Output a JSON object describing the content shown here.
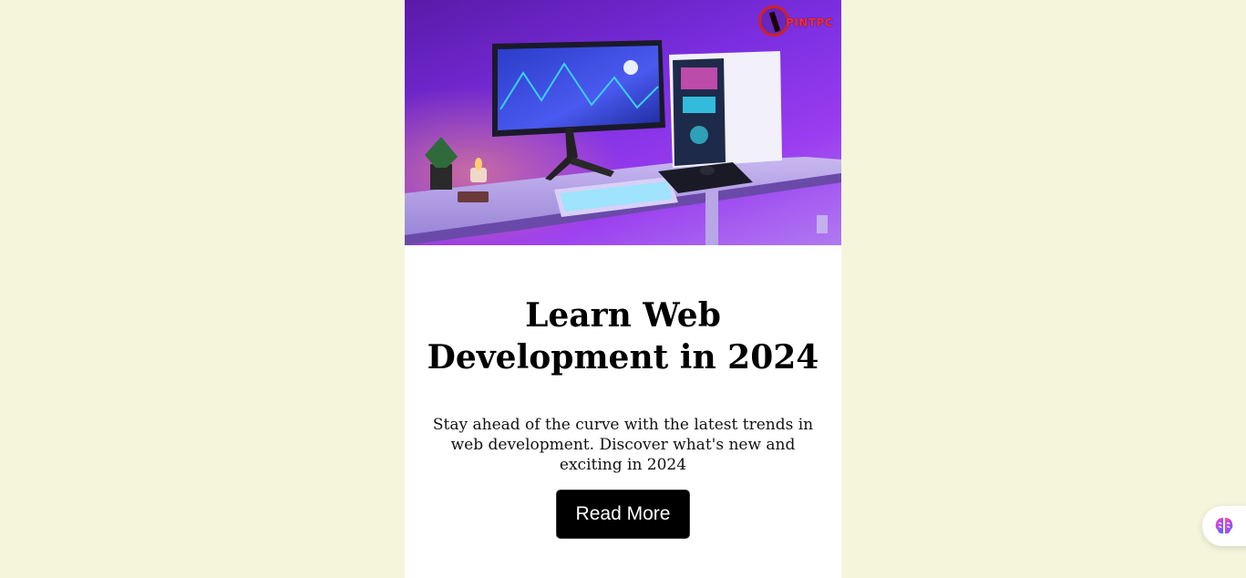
{
  "hero": {
    "image_description_icon": "desk-setup-image",
    "logo_text": "PINTPC"
  },
  "card": {
    "title": "Learn Web Development in 2024",
    "description": "Stay ahead of the curve with the latest trends in web development. Discover what's new and exciting in 2024",
    "button_label": "Read More"
  },
  "floating": {
    "icon": "brain-icon"
  },
  "colors": {
    "page_bg": "#f5f5dc",
    "card_bg": "#ffffff",
    "button_bg": "#000000",
    "button_text": "#ffffff"
  }
}
